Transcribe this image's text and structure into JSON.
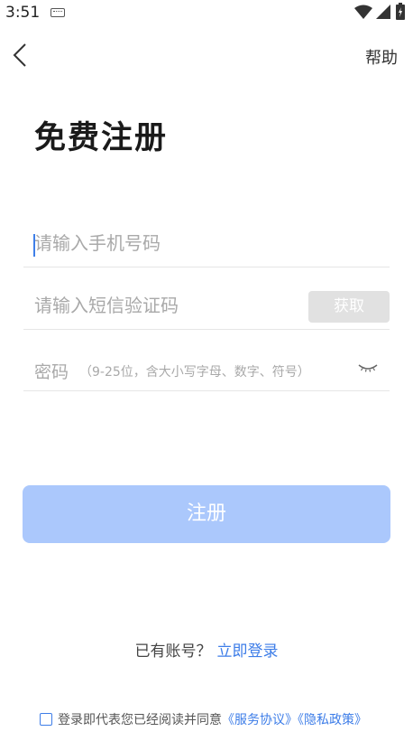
{
  "status_bar": {
    "time": "3:51",
    "keyboard_icon": "keyboard-icon",
    "wifi_icon": "wifi-icon",
    "signal_icon": "signal-icon",
    "battery_icon": "battery-icon"
  },
  "header": {
    "back_icon": "chevron-left-icon",
    "help_label": "帮助"
  },
  "page": {
    "title": "免费注册"
  },
  "form": {
    "phone_placeholder": "请输入手机号码",
    "sms_placeholder": "请输入短信验证码",
    "get_code_label": "获取",
    "password_label": "密码",
    "password_hint": "（9-25位，含大小写字母、数字、符号）",
    "eye_icon": "eye-closed-icon",
    "register_label": "注册"
  },
  "login": {
    "prefix": "已有账号？",
    "link_label": "立即登录"
  },
  "agreement": {
    "text": "登录即代表您已经阅读并同意",
    "service_link": "《服务协议》",
    "privacy_link": "《隐私政策》",
    "checked": false
  },
  "colors": {
    "accent": "#3d7de8",
    "register_button": "#abc8fc",
    "get_code_button": "#e1e1e1"
  }
}
